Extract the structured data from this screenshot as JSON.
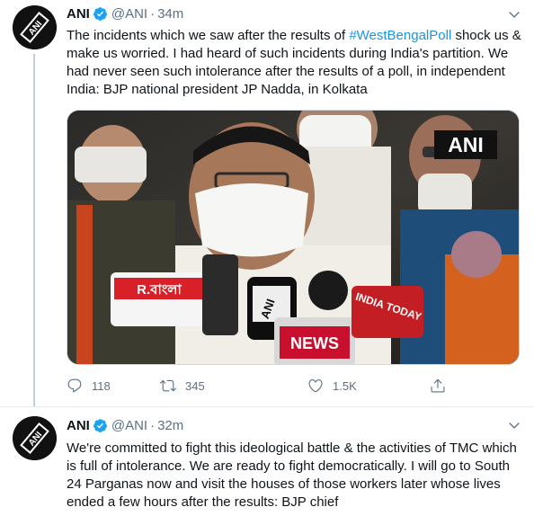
{
  "colors": {
    "text": "#0f1419",
    "secondary": "#5b7083",
    "link": "#1b95e0",
    "verified": "#1da1f2"
  },
  "tweets": [
    {
      "name": "ANI",
      "handle": "@ANI",
      "dot": "·",
      "time": "34m",
      "text_before": "The incidents which we saw after the results of ",
      "hashtag": "#WestBengalPoll",
      "text_after": " shock us & make us worried. I had heard of such incidents during India's partition. We had never seen such intolerance after the results of a poll, in independent India: BJP national president JP Nadda, in Kolkata",
      "media": {
        "watermark": "ANI",
        "mic_labels": [
          "R.বাংলা",
          "INDIA TODAY",
          "NEWS",
          "ANI"
        ]
      },
      "stats": {
        "replies": "118",
        "retweets": "345",
        "likes": "1.5K"
      }
    },
    {
      "name": "ANI",
      "handle": "@ANI",
      "dot": "·",
      "time": "32m",
      "text": "We're committed to fight this ideological battle & the activities of TMC which is full of intolerance. We are ready to fight democratically. I will go to South 24 Parganas now and visit the houses of those workers later whose lives ended a few hours after the results: BJP chief"
    }
  ],
  "icons": {
    "reply": "reply-icon",
    "retweet": "retweet-icon",
    "like": "heart-icon",
    "share": "share-icon",
    "caret": "chevron-down-icon",
    "verified": "verified-badge-icon"
  }
}
